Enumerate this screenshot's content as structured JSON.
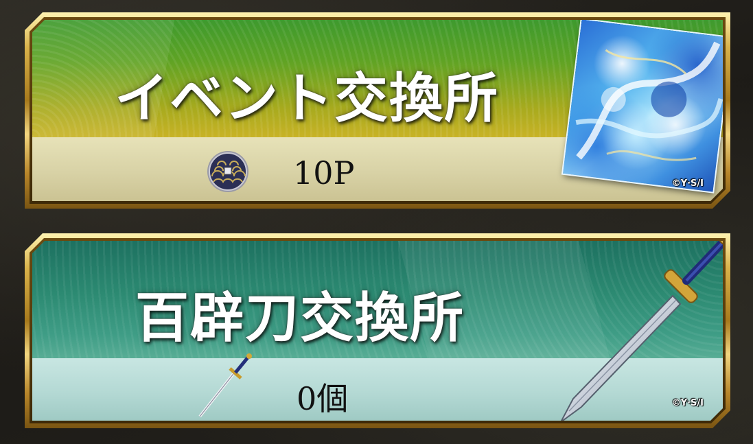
{
  "banners": [
    {
      "title": "イベント交換所",
      "amount": "10P",
      "copyright": "©Y·S/I",
      "icon": "coin-icon",
      "art": "water-dragon-artwork"
    },
    {
      "title": "百辟刀交換所",
      "amount": "0個",
      "copyright": "©Y·S/I",
      "icon": "sword-icon",
      "art": "sword-artwork"
    }
  ],
  "colors": {
    "event_panel": "#5fa324",
    "blade_panel": "#2c8a72",
    "frame_gold": "#d9b24a"
  }
}
